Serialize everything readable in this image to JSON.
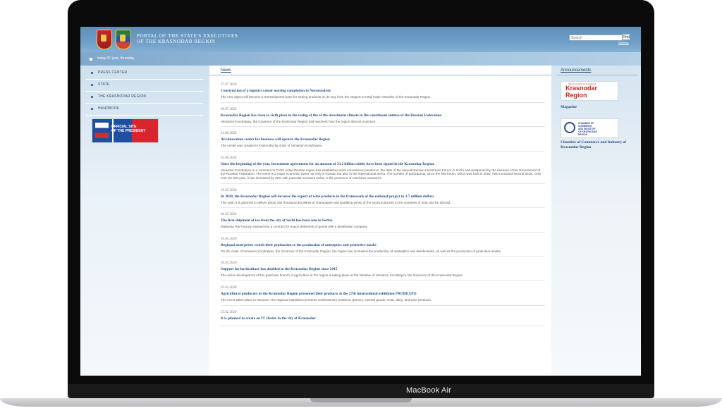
{
  "device": {
    "brand_label": "MacBook Air"
  },
  "header": {
    "portal_title": "Portal of the State's executives\nof the Krasnodar Region",
    "search": {
      "placeholder": "Search",
      "button_label": "Find"
    },
    "sitemap_label": "Sitemap"
  },
  "datebar": {
    "text": "today 07 june, thursday"
  },
  "sidebar": {
    "items": [
      {
        "label": "Press Center"
      },
      {
        "label": "State"
      },
      {
        "label": "The Krasnodar Region"
      },
      {
        "label": "Handbook"
      }
    ],
    "president_banner": "OFFICIAL SITE\nOF THE PRESIDENT"
  },
  "news": {
    "tab_label": "News",
    "items": [
      {
        "date": "27.07.2020",
        "title": "Construction of a logistics center nearing completion in Novorossiysk",
        "text": "The new object will become a transshipment base for storing products on its way from the seaport to retail trade networks of the Krasnodar Region."
      },
      {
        "date": "09.07.2020",
        "title": "Krasnodar Region has risen to sixth place in the rating of the of the investment climate in the constituent entities of the Russian Federation",
        "text": "Veniamin Kondratyev, the Governor of the Krasnodar Region told reporters how the region attracts investors."
      },
      {
        "date": "24.06.2020",
        "title": "An innovation center for business will open in the Krasnodar Region",
        "text": "The center was created in Krasnodar by order of Veniamin Kondratyev."
      },
      {
        "date": "02.06.2020",
        "title": "Since the beginning of the year, Investment agreements for an amount of 33.2 billion rubles have been signed in the Krasnodar Region.",
        "text": "Veniamin Kondratyev in a comment to TASS noted that the region has established work coronavirus pandemic, the date of the annual Russian Investment Forum in Sochi was postponed by the decision of the Government of the Russian Federation. The event is a major economic event not only in Russia, but also in the international arena. The number of participants, since the first forum, which was held in 2002, has increased several times. Only over the last year, it has increased by 30% with potential investors online in the presence of restrictive measures."
      },
      {
        "date": "19.05.2020",
        "title": "In 2020, the Krasnodar Region will increase the export of wine products in the framework of the national project to 3.7 million dollars",
        "text": "This year, it is planned to deliver about 345 thousand decalitres of champagne and sparkling wines of the local producers to the countries of near and far abroad."
      },
      {
        "date": "06.05.2020",
        "title": "The first shipment of tea from the city of Sochi has been sent to Serbia",
        "text": "Matsesta Tea Factory entered into a contract for export deliveries of goods with a distribution company."
      },
      {
        "date": "10.04.2020",
        "title": "Regional enterprises switch their production to the production of antiseptics and protective masks",
        "text": "On the order of Veniamin Kondratyev, the Governor of the Krasnodar Region, the region has increased the production of antiseptics and disinfectants, as well as the production of protective masks."
      },
      {
        "date": "30.03.2020",
        "title": "Support for horticulture has doubled in the Krasnodar Region since 2015",
        "text": "The active development of this particular branch of agriculture in the region is taking place at the initiative of Veniamin Kondratyev, the Governor of the Krasnodar Region."
      },
      {
        "date": "03.03.2020",
        "title": "Agricultural producers of the Krasnodar Region presented their products at the 27th international exhibition PRODEXPO",
        "text": "The event takes place in Moscow. The regional exposition presents confectionery products, grocery, canned goods, meat, dairy, and wine products."
      },
      {
        "date": "25.02.2020",
        "title": "It is planned to create an IT cluster in the city of Krasnodar",
        "text": ""
      }
    ]
  },
  "announcements": {
    "tab_label": "Announcements",
    "magazine": {
      "small_text": "The best place for investment",
      "logo_text": "Krasnodar\nRegion",
      "label": "Magazine"
    },
    "chamber": {
      "logo_text": "CHAMBER OF\nCOMMERCE\nAND INDUSTRY\nOF KRASNODAR\nREGION",
      "label": "Chamber of Commerce and Industry of Krasnodar Region"
    }
  },
  "colors": {
    "header_blue": "#5e8fb9",
    "link_blue": "#1f4a84",
    "sidebar_bg": "#e9f1f8"
  }
}
